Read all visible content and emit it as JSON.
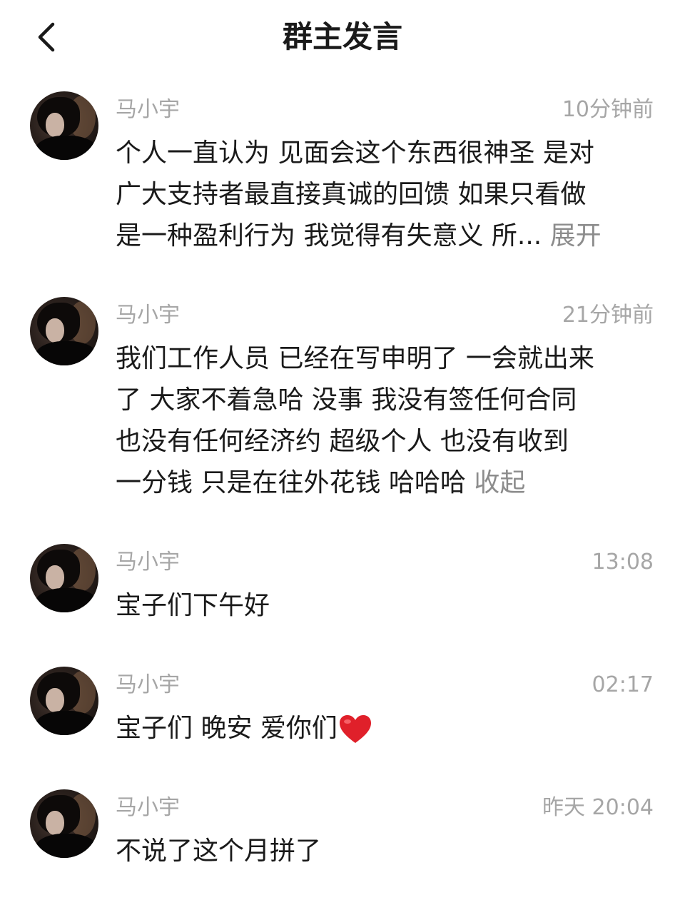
{
  "header": {
    "title": "群主发言"
  },
  "messages": [
    {
      "name": "马小宇",
      "time": "10分钟前",
      "lines": [
        "个人一直认为 见面会这个东西很神圣 是对",
        "广大支持者最直接真诚的回馈 如果只看做",
        "是一种盈利行为 我觉得有失意义 所..."
      ],
      "toggle": "展开"
    },
    {
      "name": "马小宇",
      "time": "21分钟前",
      "lines": [
        "我们工作人员  已经在写申明了 一会就出来",
        "了 大家不着急哈 没事 我没有签任何合同",
        "也没有任何经济约   超级个人  也没有收到",
        "一分钱  只是在往外花钱 哈哈哈"
      ],
      "toggle": "收起"
    },
    {
      "name": "马小宇",
      "time": "13:08",
      "lines": [
        "宝子们下午好"
      ]
    },
    {
      "name": "马小宇",
      "time": "02:17",
      "lines": [
        "宝子们 晚安 爱你们"
      ],
      "emoji": "heart-icon"
    },
    {
      "name": "马小宇",
      "time": "昨天 20:04",
      "lines": [
        "不说了这个月拼了"
      ]
    }
  ],
  "colors": {
    "meta_gray": "#a6a6a6",
    "toggle_gray": "#8c8c8c",
    "heart_red": "#e0202a",
    "text": "#1a1a1a"
  }
}
